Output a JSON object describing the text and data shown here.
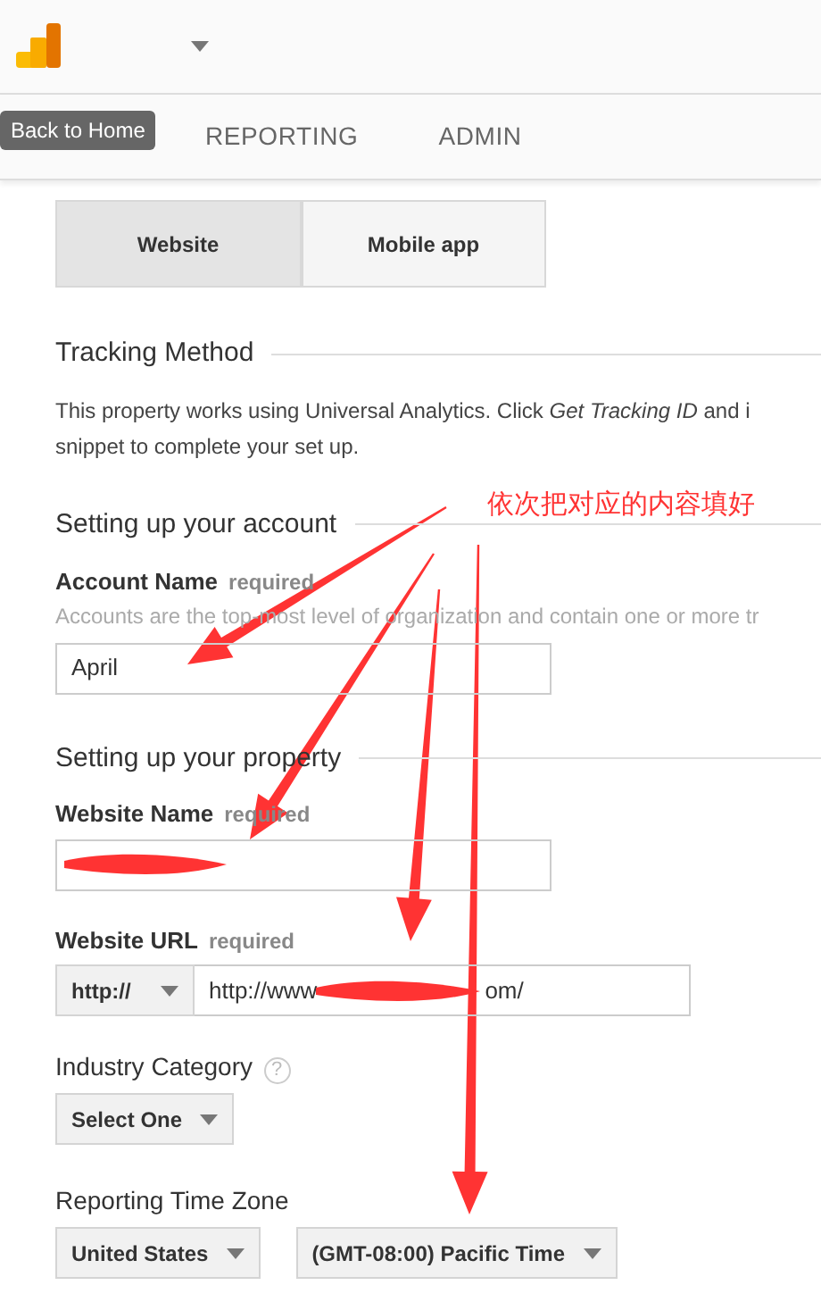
{
  "tooltip": {
    "text": "Back to Home"
  },
  "nav_tabs": [
    {
      "label": "REPORTING"
    },
    {
      "label": "ADMIN"
    }
  ],
  "type_toggle": [
    {
      "label": "Website",
      "selected": true
    },
    {
      "label": "Mobile app",
      "selected": false
    }
  ],
  "tracking": {
    "title": "Tracking Method",
    "lines": [
      "This property works using Universal Analytics. Click *Get Tracking ID* and i",
      "snippet to complete your set up."
    ]
  },
  "account": {
    "title": "Setting up your account",
    "label": "Account Name",
    "required": "required",
    "help": "Accounts are the top-most level of organization and contain one or more tr",
    "value": "April"
  },
  "property": {
    "title": "Setting up your property",
    "website_name": {
      "label": "Website Name",
      "required": "required",
      "redacted": true
    },
    "website_url": {
      "label": "Website URL",
      "required": "required",
      "protocol": "http://",
      "value_start": "http://www",
      "value_end": "om/",
      "redacted": true
    },
    "industry": {
      "label": "Industry Category",
      "help_icon": "?",
      "value": "Select One"
    },
    "time_zone": {
      "label": "Reporting Time Zone",
      "country": "United States",
      "zone": "(GMT-08:00) Pacific Time"
    }
  },
  "annotation": {
    "text": "依次把对应的内容填好",
    "arrows": [
      {
        "kind": "arrow"
      },
      {
        "kind": "arrow"
      },
      {
        "kind": "arrow"
      },
      {
        "kind": "arrow"
      }
    ]
  }
}
